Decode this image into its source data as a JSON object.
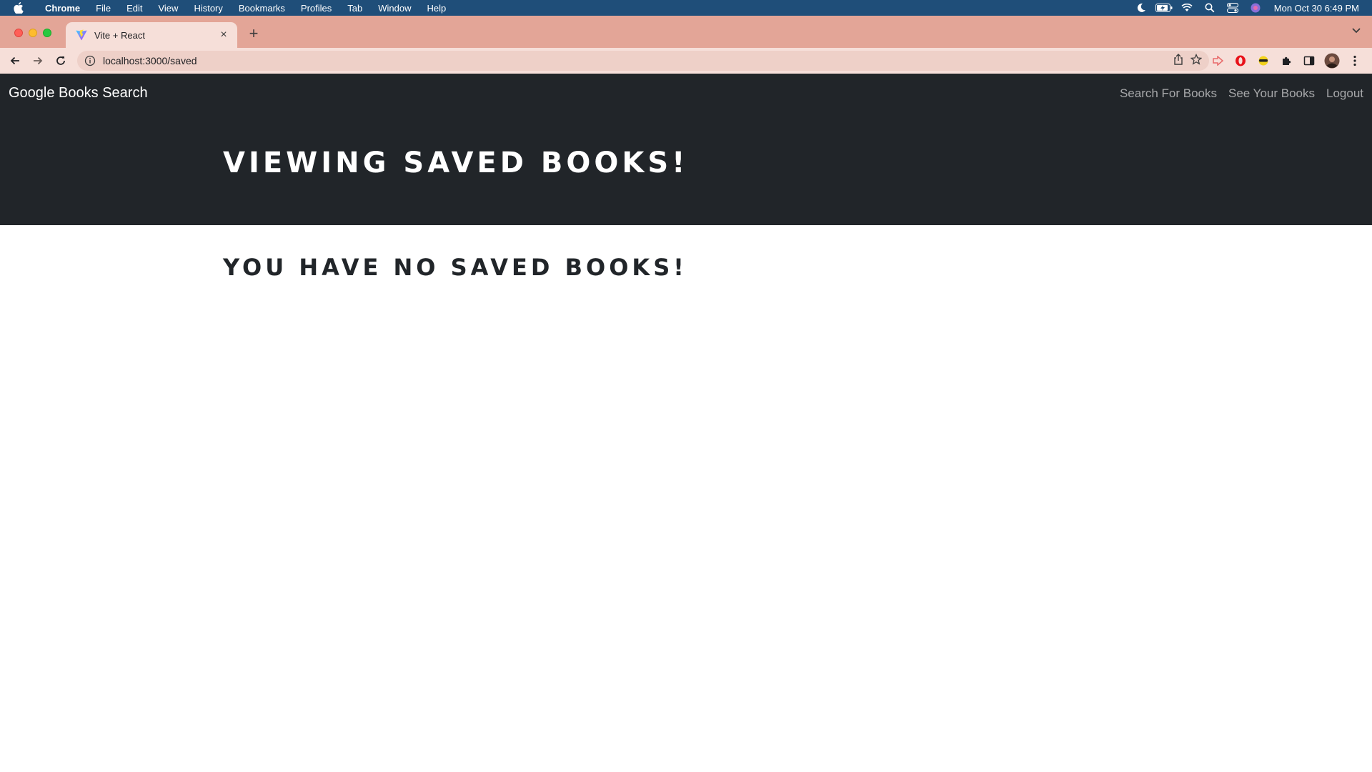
{
  "menubar": {
    "app_name": "Chrome",
    "items": [
      "File",
      "Edit",
      "View",
      "History",
      "Bookmarks",
      "Profiles",
      "Tab",
      "Window",
      "Help"
    ],
    "clock": "Mon Oct 30  6:49 PM"
  },
  "browser": {
    "tab_title": "Vite + React",
    "url": "localhost:3000/saved"
  },
  "navbar": {
    "brand": "Google Books Search",
    "links": [
      "Search For Books",
      "See Your Books",
      "Logout"
    ]
  },
  "hero": {
    "title": "Viewing saved books!"
  },
  "content": {
    "empty_message": "You have no saved books!"
  },
  "colors": {
    "menubar_bg": "#1f4e79",
    "tabstrip_bg": "#e3a597",
    "toolbar_bg": "#f6dfd9",
    "navbar_bg": "#212529"
  }
}
